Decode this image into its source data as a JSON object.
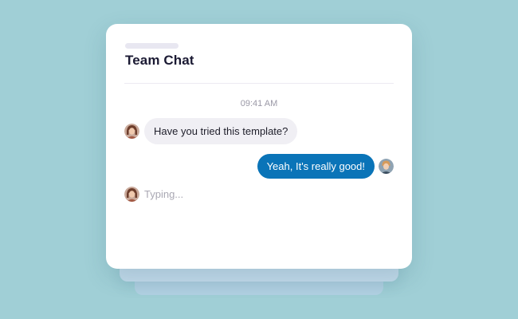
{
  "chat": {
    "title": "Team Chat",
    "timestamp": "09:41 AM",
    "messages": [
      {
        "direction": "incoming",
        "text": "Have you tried this template?",
        "avatar": "user-avatar-brown-hair"
      },
      {
        "direction": "outgoing",
        "text": "Yeah, It's really good!",
        "avatar": "user-avatar-blonde-hair"
      }
    ],
    "typing_indicator": "Typing..."
  },
  "colors": {
    "background": "#a0cfd6",
    "outgoing_bubble": "#0a74b8",
    "incoming_bubble": "#f0eff4",
    "title_text": "#1b1a33"
  }
}
